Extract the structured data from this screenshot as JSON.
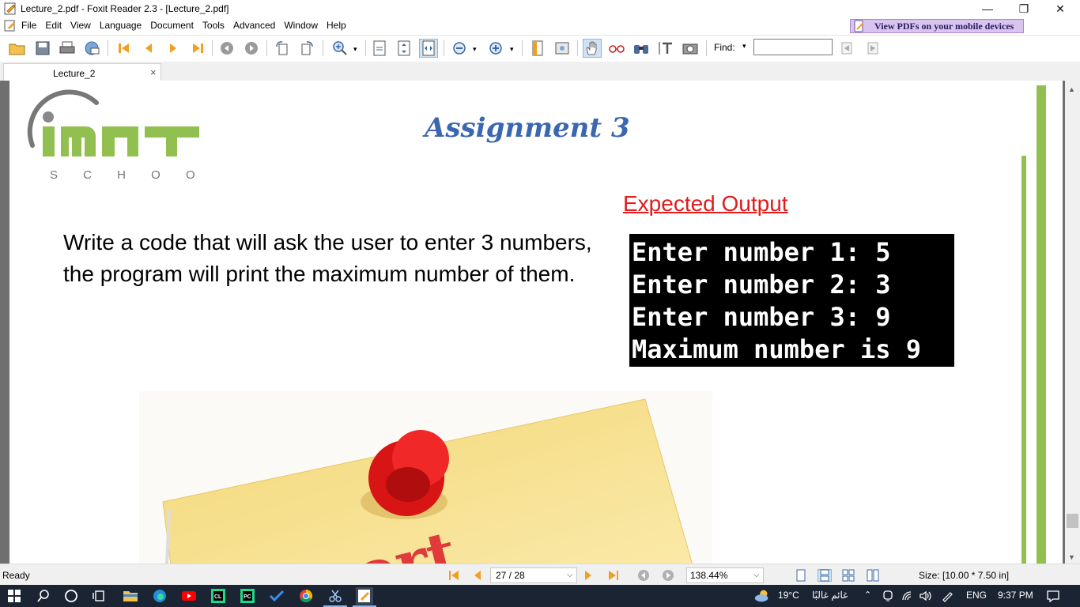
{
  "window": {
    "title": "Lecture_2.pdf - Foxit Reader 2.3 - [Lecture_2.pdf]",
    "minimize_glyph": "—",
    "restore_glyph": "❐",
    "close_glyph": "✕"
  },
  "menu": {
    "items": [
      "File",
      "Edit",
      "View",
      "Language",
      "Document",
      "Tools",
      "Advanced",
      "Window",
      "Help"
    ],
    "promo": "View PDFs on your mobile devices"
  },
  "toolbar": {
    "find_label": "Find:",
    "find_value": "",
    "find_dropdown_glyph": "▾",
    "icons": [
      "open-icon",
      "save-icon",
      "print-icon",
      "email-icon",
      "first-page-icon",
      "prev-page-icon",
      "next-page-icon",
      "last-page-icon",
      "go-back-icon",
      "go-forward-icon",
      "rotate-left-icon",
      "rotate-right-icon",
      "zoom-in-icon",
      "actual-size-icon",
      "fit-page-icon",
      "fit-width-icon",
      "zoom-out-icon",
      "zoom-in-plus-icon",
      "bookmark-icon",
      "full-screen-icon",
      "hand-tool-icon",
      "reading-glasses-icon",
      "binoculars-icon",
      "text-select-icon",
      "snapshot-icon",
      "find-prev-icon",
      "find-next-icon"
    ]
  },
  "tabs": [
    {
      "label": "Lecture_2",
      "close_glyph": "×"
    }
  ],
  "slide": {
    "logo_text": "iMT",
    "logo_subtext": "S C H O O L",
    "title": "Assignment 3",
    "expected_label": "Expected Output",
    "question": "Write a code that will ask the user to enter 3 numbers, the program will print the maximum number of them.",
    "console_lines": [
      "Enter number 1: 5",
      "Enter number 2: 3",
      "Enter number 3: 9",
      "Maximum number is 9"
    ],
    "sticky_text": "ort",
    "colors": {
      "logo_green": "#92c050",
      "title_blue": "#3a67b0",
      "expected_red": "#e01c1c",
      "pin_red": "#e81818",
      "note_yellow": "#f8e08a"
    }
  },
  "status": {
    "ready": "Ready",
    "page": "27 / 28",
    "zoom": "138.44%",
    "size": "Size: [10.00 * 7.50 in]",
    "dropdown_glyph": "⌵"
  },
  "taskbar": {
    "apps": [
      "windows-start-icon",
      "search-icon",
      "cortana-icon",
      "task-view-icon",
      "file-explorer-icon",
      "edge-icon",
      "youtube-icon",
      "clion-icon",
      "pycharm-icon",
      "todo-icon",
      "chrome-icon",
      "snipping-tool-icon",
      "foxit-reader-icon"
    ],
    "temperature": "19°C",
    "weather_text": "غائم غالبًا",
    "language": "ENG",
    "time": "9:37 PM"
  }
}
